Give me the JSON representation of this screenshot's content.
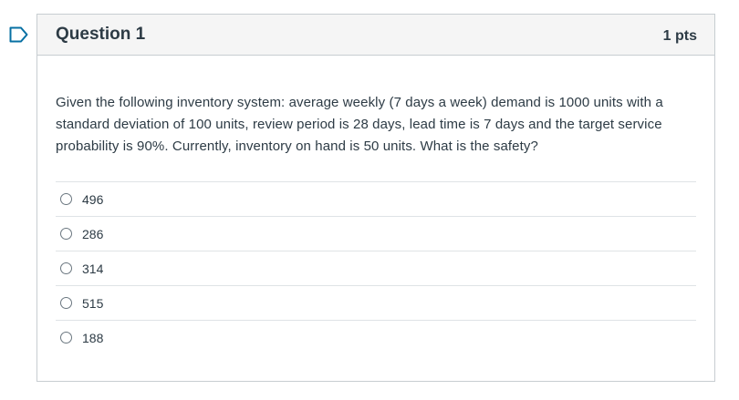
{
  "question": {
    "title": "Question 1",
    "points": "1 pts",
    "text": "Given the following inventory system: average weekly (7 days a week) demand is 1000 units with a standard deviation of 100 units, review period is 28 days, lead time is 7 days and the target service probability is 90%. Currently, inventory on hand is 50 units. What is the safety?",
    "answers": [
      {
        "label": "496",
        "selected": false
      },
      {
        "label": "286",
        "selected": false
      },
      {
        "label": "314",
        "selected": false
      },
      {
        "label": "515",
        "selected": false
      },
      {
        "label": "188",
        "selected": false
      }
    ]
  },
  "colors": {
    "flag": "#0770a3",
    "header_bg": "#f5f5f5",
    "border": "#c7cdd1",
    "text": "#2d3b45"
  },
  "icons": {
    "flag": "bookmark-flag-icon",
    "radio": "radio-unselected-icon"
  }
}
